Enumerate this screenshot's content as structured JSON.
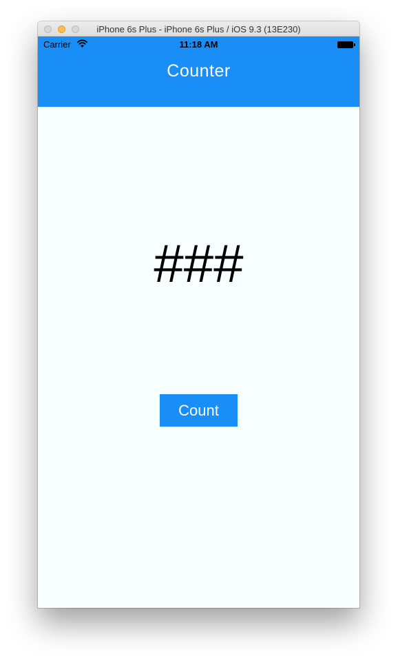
{
  "window": {
    "title": "iPhone 6s Plus - iPhone 6s Plus / iOS 9.3 (13E230)"
  },
  "status_bar": {
    "carrier": "Carrier",
    "time": "11:18 AM",
    "icons": [
      "wifi-icon",
      "battery-icon"
    ]
  },
  "nav": {
    "title": "Counter"
  },
  "counter": {
    "value": "###"
  },
  "count_button": {
    "label": "Count"
  },
  "colors": {
    "accent": "#1a8ef7",
    "background": "#f8ffff",
    "text": "#000000"
  }
}
